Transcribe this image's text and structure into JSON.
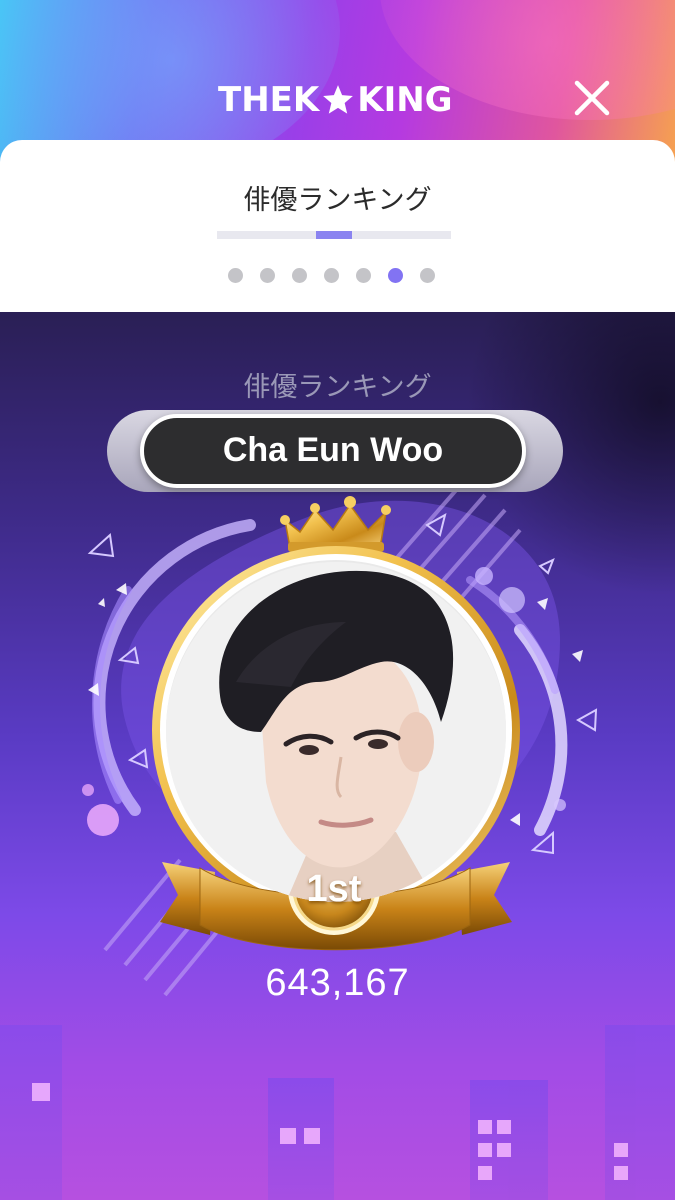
{
  "header": {
    "logo_text_left": "THEK",
    "logo_text_right": "KING",
    "close_icon": "close-icon",
    "colors": {
      "gradient_start": "#44c8f5",
      "gradient_mid": "#9a3fe8",
      "gradient_end": "#f6a24f"
    }
  },
  "card": {
    "title": "俳優ランキング",
    "progress": 0.5,
    "pages": {
      "total": 7,
      "active": 6
    },
    "colors": {
      "active_dot": "#8273f3",
      "inactive_dot": "#c4c4c8"
    }
  },
  "ranking": {
    "category": "俳優ランキング",
    "name": "Cha Eun Woo",
    "rank": "1st",
    "votes": "643,167",
    "icons": {
      "crown": "crown-icon",
      "ribbon": "ribbon-icon",
      "portrait": "portrait-photo"
    }
  }
}
